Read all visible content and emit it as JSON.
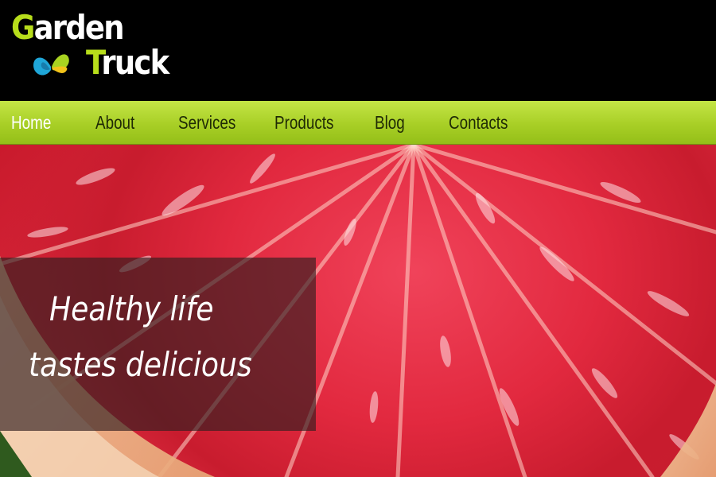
{
  "logo": {
    "line1_initial": "G",
    "line1_rest": "arden",
    "line2_initial": "T",
    "line2_rest": "ruck",
    "accent_color": "#b7dd1b",
    "icon": "butterfly-icon"
  },
  "nav": {
    "items": [
      {
        "label": "Home",
        "active": true
      },
      {
        "label": "About",
        "active": false
      },
      {
        "label": "Services",
        "active": false
      },
      {
        "label": "Products",
        "active": false
      },
      {
        "label": "Blog",
        "active": false
      },
      {
        "label": "Contacts",
        "active": false
      }
    ],
    "bar_color": "#a8cf26"
  },
  "hero": {
    "caption_line1": "Healthy life",
    "caption_line2": "tastes delicious",
    "image_subject": "grapefruit-slice"
  }
}
